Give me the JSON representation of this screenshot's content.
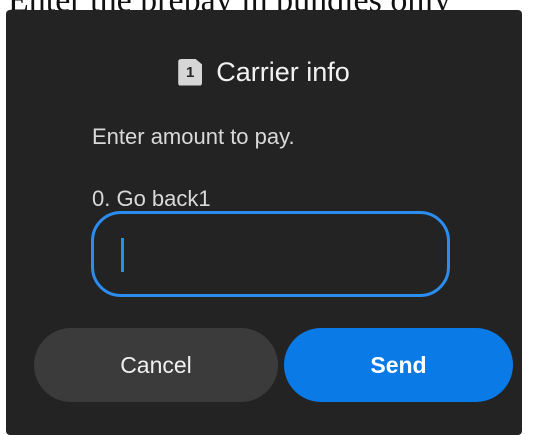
{
  "background": {
    "partial_text": "Enter the prepay in bundles only"
  },
  "dialog": {
    "sim_badge": "1",
    "title": "Carrier info",
    "message": "Enter amount to pay.",
    "option": "0. Go back1",
    "input_value": "",
    "cancel_label": "Cancel",
    "send_label": "Send"
  },
  "colors": {
    "dialog_bg": "#232323",
    "accent": "#2c8df0",
    "send_button": "#0a7ae6",
    "cancel_button": "#3b3b3b"
  },
  "icons": {
    "sim": "sim-card-icon"
  }
}
